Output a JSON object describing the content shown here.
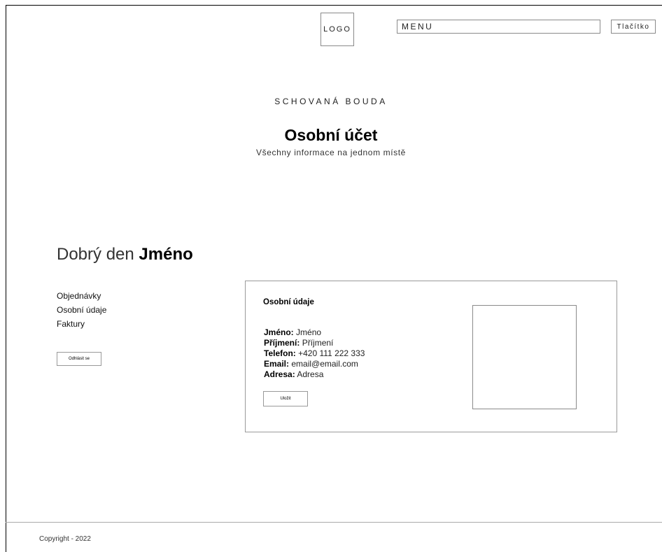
{
  "header": {
    "logo_text": "LOGO",
    "menu_label": "MENU",
    "button_label": "Tlačítko"
  },
  "hero": {
    "brand": "SCHOVANÁ BOUDA",
    "title": "Osobní účet",
    "subtitle": "Všechny informace na jednom místě"
  },
  "greeting": {
    "prefix": "Dobrý den",
    "name": "Jméno"
  },
  "sidebar": {
    "items": [
      {
        "label": "Objednávky"
      },
      {
        "label": "Osobní údaje"
      },
      {
        "label": "Faktury"
      }
    ],
    "logout_label": "Odhlásit se"
  },
  "card": {
    "title": "Osobní údaje",
    "fields": [
      {
        "label": "Jméno:",
        "value": "Jméno"
      },
      {
        "label": "Příjmení:",
        "value": "Příjmení"
      },
      {
        "label": "Telefon:",
        "value": "+420 111 222 333"
      },
      {
        "label": "Email:",
        "value": "email@email.com"
      },
      {
        "label": "Adresa:",
        "value": "Adresa"
      }
    ],
    "save_label": "Uložit"
  },
  "footer": {
    "copyright": "Copyright - 2022"
  }
}
